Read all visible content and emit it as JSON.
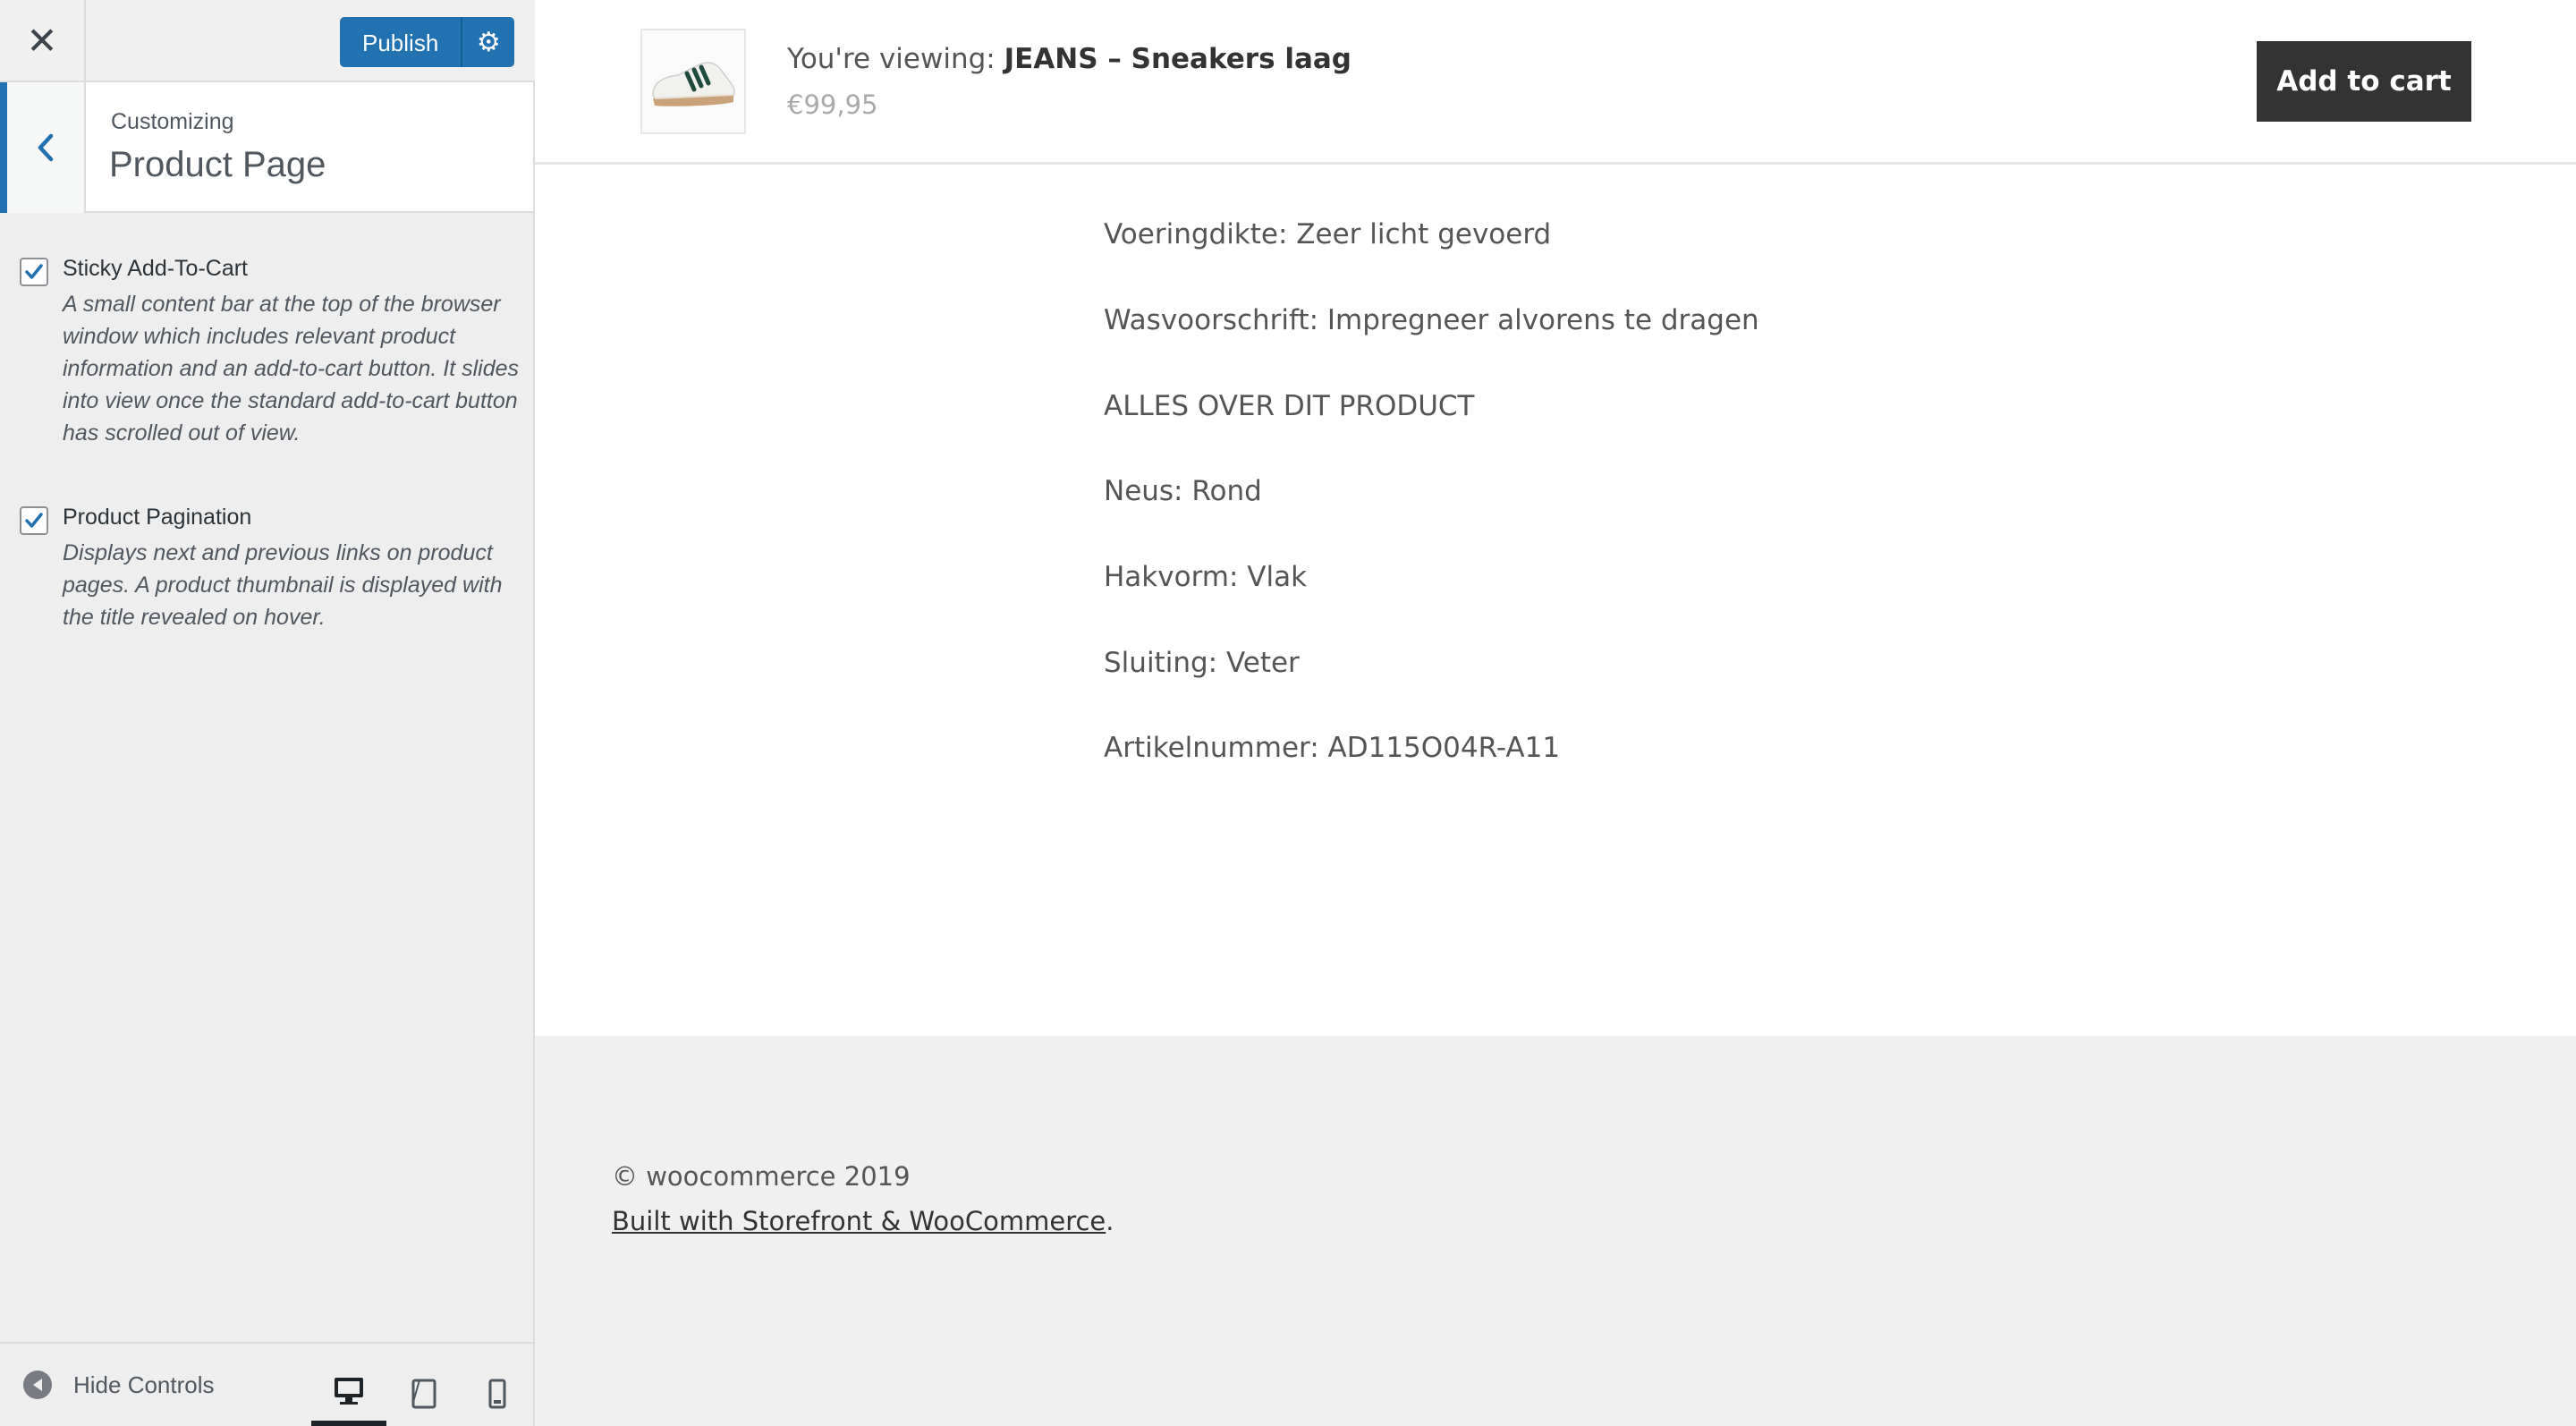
{
  "customizer": {
    "close_icon": "close-icon",
    "publish_label": "Publish",
    "publish_settings_icon": "gear-icon",
    "back_icon": "chevron-left-icon",
    "customizing_label": "Customizing",
    "section_title": "Product Page",
    "controls": [
      {
        "label": "Sticky Add-To-Cart",
        "checked": true,
        "description": "A small content bar at the top of the browser window which includes relevant product information and an add-to-cart button. It slides into view once the standard add-to-cart button has scrolled out of view."
      },
      {
        "label": "Product Pagination",
        "checked": true,
        "description": "Displays next and previous links on product pages. A product thumbnail is displayed with the title revealed on hover."
      }
    ],
    "footer": {
      "hide_controls_label": "Hide Controls",
      "devices": [
        "desktop",
        "tablet",
        "mobile"
      ],
      "active_device": "desktop"
    }
  },
  "preview": {
    "sticky_bar": {
      "viewing_prefix": "You're viewing: ",
      "product_name": "JEANS – Sneakers laag",
      "price": "€99,95",
      "add_to_cart_label": "Add to cart"
    },
    "specs": [
      "Voeringdikte: Zeer licht gevoerd",
      "Wasvoorschrift: Impregneer alvorens te dragen",
      "ALLES OVER DIT PRODUCT",
      "Neus: Rond",
      "Hakvorm: Vlak",
      "Sluiting: Veter",
      "Artikelnummer: AD115O04R-A11"
    ],
    "footer": {
      "copyright": "© woocommerce 2019",
      "credit_link": "Built with Storefront & WooCommerce",
      "credit_suffix": "."
    }
  },
  "colors": {
    "accent": "#2271b1",
    "button_dark": "#333333",
    "sidebar_bg": "#eeeeee"
  }
}
